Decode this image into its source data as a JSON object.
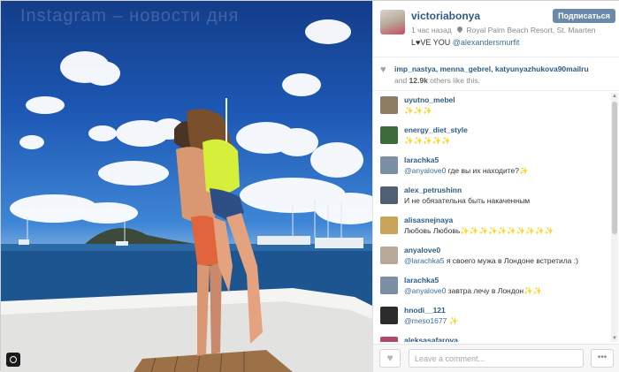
{
  "photo": {
    "watermark": "Instagram – новости дня",
    "alt": "photo-couple-on-yacht-bow"
  },
  "post": {
    "owner": "victoriabonya",
    "follow_label": "Подписаться",
    "time_ago": "1 час назад",
    "location": "Royal Palm Beach Resort, St. Maarten",
    "caption_text": "L♥VE YOU ",
    "caption_mention": "@alexandersmurfit"
  },
  "likes": {
    "likers": "imp_nastya, menna_gebrel, katyunyazhukova90mailru",
    "and": "and ",
    "count": "12.9k",
    "others": " others like this."
  },
  "comments": [
    {
      "user": "uyutno_mebel",
      "mention": "",
      "text": "✨✨✨",
      "avatar_color": "#8d7b62"
    },
    {
      "user": "energy_diet_style",
      "mention": "",
      "text": "✨✨✨✨✨",
      "avatar_color": "#3e6b3a"
    },
    {
      "user": "larachka5",
      "mention": "@anyalove0",
      "text": " где вы их находите?✨",
      "avatar_color": "#7c8ea6"
    },
    {
      "user": "alex_petrushinn",
      "mention": "",
      "text": "И не обязательна быть накаченным",
      "avatar_color": "#4f5f74"
    },
    {
      "user": "alisasnejnaya",
      "mention": "",
      "text": "Любовь Любовь✨✨✨✨✨✨✨✨✨✨",
      "avatar_color": "#c9a35a"
    },
    {
      "user": "anyalove0",
      "mention": "@larachka5",
      "text": " я своего мужа в Лондоне встретила :)",
      "avatar_color": "#b9a99b"
    },
    {
      "user": "larachka5",
      "mention": "@anyalove0",
      "text": " завтра лечу в Лондон✨✨",
      "avatar_color": "#7c8ea6"
    },
    {
      "user": "hnodi__121",
      "mention": "@meso1677",
      "text": " ✨",
      "avatar_color": "#2c2c2c"
    },
    {
      "user": "aleksasafarova",
      "mention": "",
      "text": "",
      "avatar_color": "#b04a6a"
    }
  ],
  "footer": {
    "comment_placeholder": "Leave a comment...",
    "heart_icon": "♥",
    "more_icon": "•••"
  },
  "scrollbar": {
    "up": "▲",
    "down": "▼"
  }
}
